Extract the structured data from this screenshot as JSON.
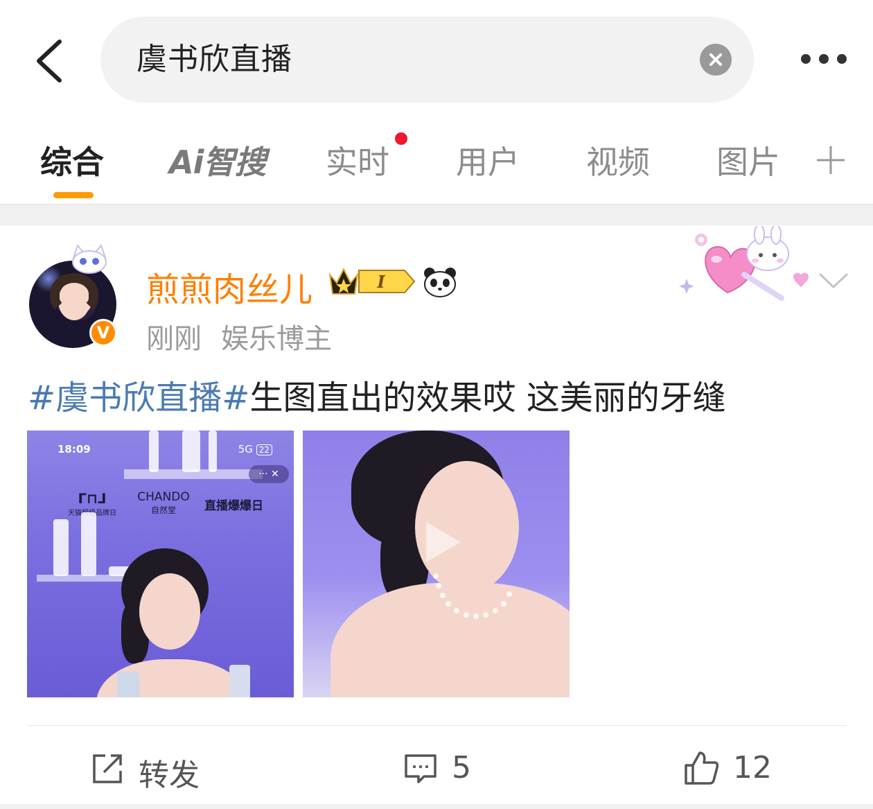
{
  "search": {
    "query": "虞书欣直播"
  },
  "tabs": [
    {
      "label": "综合",
      "active": true
    },
    {
      "label": "Ai智搜"
    },
    {
      "label": "实时",
      "has_dot": true
    },
    {
      "label": "用户"
    },
    {
      "label": "视频"
    },
    {
      "label": "图片"
    }
  ],
  "post": {
    "username": "煎煎肉丝儿",
    "vip_level": "I",
    "time": "刚刚",
    "tag": "娱乐博主",
    "verified_mark": "V",
    "text_hashtag": "#虞书欣直播#",
    "text_body": "生图直出的效果哎 这美丽的牙缝",
    "images": [
      {
        "status_time": "18:09",
        "status_network": "5G",
        "status_battery": "22",
        "mini_controls": "··· ✕",
        "brand_left": "天猫超级品牌日",
        "brand_name": "CHANDO",
        "brand_cn": "自然堂",
        "brand_right": "直播爆爆日"
      },
      {
        "has_play_icon": true
      }
    ]
  },
  "actions": {
    "repost_label": "转发",
    "comment_count": "5",
    "like_count": "12"
  },
  "colors": {
    "accent": "#ff9a00",
    "username": "#ff7f00",
    "hashtag": "#4a7bb0",
    "red_dot": "#f0172c"
  },
  "icons": [
    "back-arrow-icon",
    "clear-icon",
    "more-icon",
    "add-tab-icon",
    "crown-icon",
    "panda-icon",
    "chevron-down-icon",
    "repost-icon",
    "comment-icon",
    "like-icon",
    "play-icon"
  ]
}
